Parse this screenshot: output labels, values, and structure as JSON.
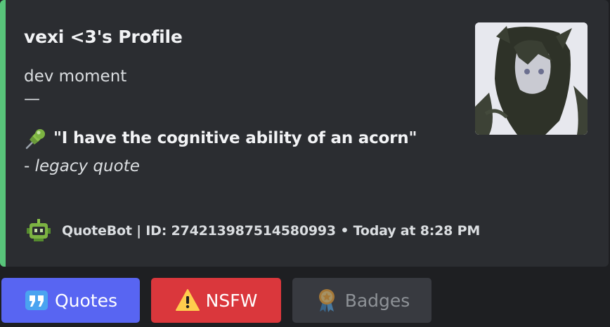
{
  "embed": {
    "accent_color": "#58c47a",
    "title": "vexi <3's Profile",
    "description_line1": "dev moment",
    "description_line2": "—",
    "quote_icon": "pushpin-icon",
    "quote": "\"I have the cognitive ability of an acorn\"",
    "attribution_prefix": "- ",
    "attribution_label": "legacy quote",
    "thumbnail": "avatar-anime-girl",
    "footer": {
      "icon": "robot-icon",
      "text": "QuoteBot | ID: 274213987514580993 • Today at 8:28 PM"
    }
  },
  "buttons": [
    {
      "label": "Quotes",
      "icon": "quote-marks-icon",
      "color": "#5865f2",
      "disabled": false
    },
    {
      "label": "NSFW",
      "icon": "warning-icon",
      "color": "#da373c",
      "disabled": false
    },
    {
      "label": "Badges",
      "icon": "medal-icon",
      "color": "#383a40",
      "disabled": true
    }
  ]
}
